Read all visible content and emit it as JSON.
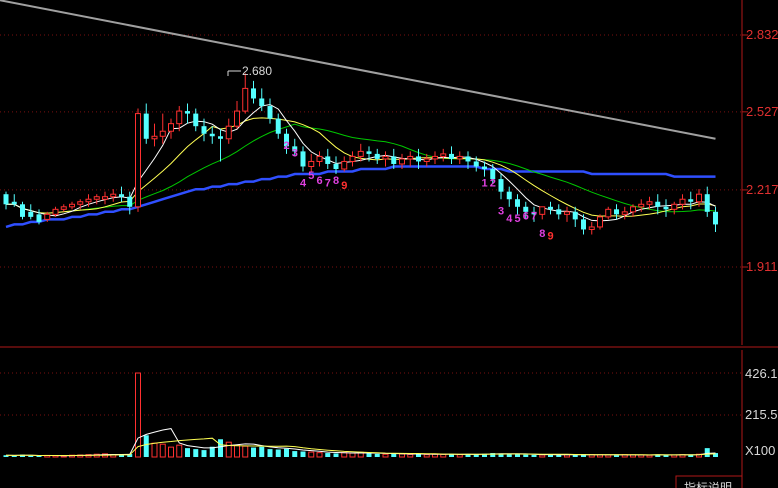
{
  "chart_data": [
    {
      "type": "candlestick",
      "title": "",
      "y_ticks": [
        "2.832",
        "2.527",
        "2.217",
        "1.911"
      ],
      "ylim": [
        1.75,
        2.97
      ],
      "peak_label": "2.680",
      "grid": "horizontal-dotted",
      "colors": {
        "up": "#ff3030",
        "down": "#54ffff",
        "ma_short": "#ffffff",
        "ma_mid": "#ffff54",
        "ma_long": "#00c800",
        "ma_slow": "#2f4fff",
        "ma_trend": "#a0a0a0"
      },
      "candles": [
        [
          2.2,
          2.21,
          2.16,
          2.14
        ],
        [
          2.17,
          2.2,
          2.16,
          2.15
        ],
        [
          2.16,
          2.17,
          2.11,
          2.1
        ],
        [
          2.13,
          2.16,
          2.11,
          2.1
        ],
        [
          2.12,
          2.14,
          2.09,
          2.08
        ],
        [
          2.1,
          2.13,
          2.12,
          2.09
        ],
        [
          2.12,
          2.15,
          2.14,
          2.11
        ],
        [
          2.14,
          2.16,
          2.15,
          2.13
        ],
        [
          2.15,
          2.17,
          2.16,
          2.14
        ],
        [
          2.16,
          2.18,
          2.17,
          2.14
        ],
        [
          2.17,
          2.2,
          2.18,
          2.15
        ],
        [
          2.18,
          2.2,
          2.19,
          2.16
        ],
        [
          2.18,
          2.21,
          2.19,
          2.16
        ],
        [
          2.19,
          2.22,
          2.2,
          2.17
        ],
        [
          2.2,
          2.23,
          2.19,
          2.17
        ],
        [
          2.19,
          2.21,
          2.15,
          2.12
        ],
        [
          2.15,
          2.54,
          2.52,
          2.13
        ],
        [
          2.52,
          2.56,
          2.42,
          2.4
        ],
        [
          2.42,
          2.48,
          2.43,
          2.39
        ],
        [
          2.43,
          2.52,
          2.45,
          2.4
        ],
        [
          2.45,
          2.5,
          2.48,
          2.42
        ],
        [
          2.48,
          2.55,
          2.53,
          2.45
        ],
        [
          2.53,
          2.56,
          2.52,
          2.48
        ],
        [
          2.52,
          2.54,
          2.47,
          2.45
        ],
        [
          2.47,
          2.5,
          2.44,
          2.41
        ],
        [
          2.44,
          2.47,
          2.43,
          2.4
        ],
        [
          2.43,
          2.46,
          2.42,
          2.33
        ],
        [
          2.42,
          2.5,
          2.47,
          2.4
        ],
        [
          2.47,
          2.57,
          2.53,
          2.46
        ],
        [
          2.53,
          2.68,
          2.62,
          2.52
        ],
        [
          2.62,
          2.65,
          2.58,
          2.56
        ],
        [
          2.58,
          2.62,
          2.55,
          2.53
        ],
        [
          2.55,
          2.58,
          2.5,
          2.48
        ],
        [
          2.5,
          2.52,
          2.44,
          2.42
        ],
        [
          2.44,
          2.46,
          2.39,
          2.36
        ],
        [
          2.39,
          2.42,
          2.37,
          2.35
        ],
        [
          2.37,
          2.39,
          2.31,
          2.29
        ],
        [
          2.31,
          2.36,
          2.33,
          2.29
        ],
        [
          2.33,
          2.37,
          2.35,
          2.31
        ],
        [
          2.35,
          2.38,
          2.32,
          2.3
        ],
        [
          2.32,
          2.35,
          2.3,
          2.28
        ],
        [
          2.3,
          2.35,
          2.33,
          2.29
        ],
        [
          2.33,
          2.37,
          2.35,
          2.31
        ],
        [
          2.35,
          2.4,
          2.37,
          2.33
        ],
        [
          2.37,
          2.39,
          2.36,
          2.33
        ],
        [
          2.36,
          2.38,
          2.34,
          2.32
        ],
        [
          2.34,
          2.37,
          2.35,
          2.31
        ],
        [
          2.35,
          2.38,
          2.32,
          2.3
        ],
        [
          2.32,
          2.36,
          2.34,
          2.3
        ],
        [
          2.34,
          2.37,
          2.35,
          2.31
        ],
        [
          2.35,
          2.38,
          2.33,
          2.3
        ],
        [
          2.33,
          2.36,
          2.34,
          2.31
        ],
        [
          2.34,
          2.37,
          2.35,
          2.32
        ],
        [
          2.35,
          2.38,
          2.36,
          2.33
        ],
        [
          2.36,
          2.39,
          2.34,
          2.32
        ],
        [
          2.34,
          2.37,
          2.35,
          2.32
        ],
        [
          2.35,
          2.37,
          2.33,
          2.3
        ],
        [
          2.33,
          2.35,
          2.31,
          2.29
        ],
        [
          2.31,
          2.33,
          2.3,
          2.27
        ],
        [
          2.3,
          2.32,
          2.26,
          2.24
        ],
        [
          2.26,
          2.28,
          2.21,
          2.18
        ],
        [
          2.21,
          2.23,
          2.18,
          2.15
        ],
        [
          2.18,
          2.2,
          2.15,
          2.12
        ],
        [
          2.15,
          2.17,
          2.13,
          2.1
        ],
        [
          2.13,
          2.15,
          2.12,
          2.09
        ],
        [
          2.12,
          2.14,
          2.15,
          2.1
        ],
        [
          2.15,
          2.17,
          2.14,
          2.12
        ],
        [
          2.14,
          2.16,
          2.12,
          2.1
        ],
        [
          2.12,
          2.15,
          2.13,
          2.09
        ],
        [
          2.13,
          2.15,
          2.1,
          2.07
        ],
        [
          2.1,
          2.12,
          2.06,
          2.04
        ],
        [
          2.06,
          2.09,
          2.07,
          2.04
        ],
        [
          2.07,
          2.12,
          2.11,
          2.06
        ],
        [
          2.11,
          2.15,
          2.14,
          2.1
        ],
        [
          2.14,
          2.16,
          2.12,
          2.1
        ],
        [
          2.12,
          2.15,
          2.13,
          2.1
        ],
        [
          2.13,
          2.16,
          2.15,
          2.11
        ],
        [
          2.15,
          2.18,
          2.16,
          2.13
        ],
        [
          2.16,
          2.19,
          2.17,
          2.14
        ],
        [
          2.17,
          2.2,
          2.15,
          2.12
        ],
        [
          2.15,
          2.18,
          2.14,
          2.11
        ],
        [
          2.14,
          2.17,
          2.16,
          2.12
        ],
        [
          2.16,
          2.2,
          2.18,
          2.14
        ],
        [
          2.18,
          2.21,
          2.17,
          2.14
        ],
        [
          2.17,
          2.22,
          2.2,
          2.15
        ],
        [
          2.2,
          2.23,
          2.13,
          2.11
        ],
        [
          2.13,
          2.15,
          2.08,
          2.05
        ]
      ],
      "sequence_labels": [
        {
          "text": "2",
          "idx": 34,
          "price": 2.38,
          "color": "#e040e0"
        },
        {
          "text": "3",
          "idx": 35,
          "price": 2.35,
          "color": "#e040e0"
        },
        {
          "text": "4",
          "idx": 36,
          "price": 2.23,
          "color": "#e040e0"
        },
        {
          "text": "5",
          "idx": 37,
          "price": 2.26,
          "color": "#e040e0"
        },
        {
          "text": "6",
          "idx": 38,
          "price": 2.24,
          "color": "#e040e0"
        },
        {
          "text": "7",
          "idx": 39,
          "price": 2.23,
          "color": "#e040e0"
        },
        {
          "text": "8",
          "idx": 40,
          "price": 2.24,
          "color": "#e040e0"
        },
        {
          "text": "9",
          "idx": 41,
          "price": 2.22,
          "color": "#ff3030"
        },
        {
          "text": "1",
          "idx": 58,
          "price": 2.23,
          "color": "#e040e0"
        },
        {
          "text": "2",
          "idx": 59,
          "price": 2.23,
          "color": "#e040e0"
        },
        {
          "text": "3",
          "idx": 60,
          "price": 2.12,
          "color": "#e040e0"
        },
        {
          "text": "4",
          "idx": 61,
          "price": 2.09,
          "color": "#e040e0"
        },
        {
          "text": "5",
          "idx": 62,
          "price": 2.09,
          "color": "#e040e0"
        },
        {
          "text": "6",
          "idx": 63,
          "price": 2.1,
          "color": "#e040e0"
        },
        {
          "text": "7",
          "idx": 64,
          "price": 2.1,
          "color": "#e040e0"
        },
        {
          "text": "8",
          "idx": 65,
          "price": 2.03,
          "color": "#e040e0"
        },
        {
          "text": "9",
          "idx": 66,
          "price": 2.02,
          "color": "#ff3030"
        }
      ],
      "ma_trend_endpoints": [
        2.97,
        2.42
      ],
      "ma_slow": [
        2.07,
        2.08,
        2.08,
        2.09,
        2.09,
        2.1,
        2.1,
        2.1,
        2.11,
        2.11,
        2.12,
        2.12,
        2.13,
        2.13,
        2.14,
        2.14,
        2.15,
        2.16,
        2.17,
        2.18,
        2.19,
        2.2,
        2.21,
        2.22,
        2.22,
        2.23,
        2.23,
        2.24,
        2.24,
        2.25,
        2.25,
        2.26,
        2.26,
        2.27,
        2.27,
        2.28,
        2.28,
        2.28,
        2.28,
        2.29,
        2.29,
        2.29,
        2.29,
        2.3,
        2.3,
        2.3,
        2.3,
        2.31,
        2.31,
        2.31,
        2.31,
        2.31,
        2.31,
        2.31,
        2.31,
        2.31,
        2.31,
        2.31,
        2.3,
        2.3,
        2.3,
        2.29,
        2.29,
        2.29,
        2.29,
        2.29,
        2.29,
        2.29,
        2.29,
        2.29,
        2.29,
        2.28,
        2.28,
        2.28,
        2.28,
        2.28,
        2.28,
        2.28,
        2.28,
        2.28,
        2.28,
        2.27,
        2.27,
        2.27,
        2.27,
        2.27,
        2.27
      ]
    },
    {
      "type": "bar",
      "title": "",
      "y_ticks": [
        "426.10",
        "215.50"
      ],
      "unit_label": "X100",
      "colors": {
        "up": "#ff3030",
        "down": "#54ffff",
        "line": "#ffffff"
      },
      "values": [
        9,
        7,
        12,
        6,
        5,
        8,
        7,
        6,
        9,
        10,
        12,
        14,
        16,
        12,
        10,
        15,
        426,
        110,
        70,
        65,
        50,
        60,
        45,
        40,
        35,
        52,
        90,
        75,
        60,
        55,
        48,
        52,
        40,
        38,
        42,
        30,
        28,
        25,
        22,
        20,
        18,
        22,
        20,
        24,
        18,
        16,
        14,
        18,
        15,
        13,
        16,
        12,
        14,
        13,
        15,
        12,
        14,
        13,
        16,
        20,
        18,
        15,
        14,
        12,
        11,
        10,
        13,
        12,
        11,
        10,
        14,
        12,
        11,
        10,
        9,
        12,
        11,
        10,
        9,
        13,
        11,
        10,
        12,
        11,
        14,
        45,
        20
      ]
    }
  ],
  "tab": {
    "label": "指标说明"
  }
}
